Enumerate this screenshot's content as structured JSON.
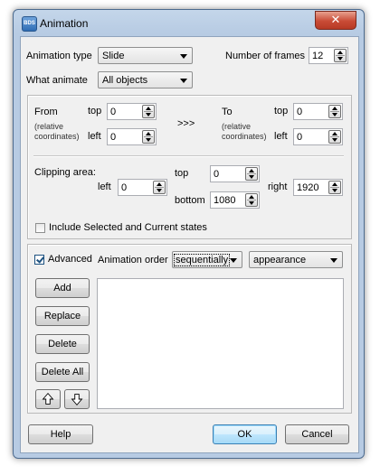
{
  "window": {
    "title": "Animation",
    "close_glyph": "✕",
    "app_icon_text": "BDS"
  },
  "top": {
    "animation_type_label": "Animation type",
    "animation_type_value": "Slide",
    "what_animate_label": "What animate",
    "what_animate_value": "All objects",
    "frames_label": "Number of frames",
    "frames_value": "12"
  },
  "position": {
    "from_label": "From",
    "relative_label_1": "(relative",
    "relative_label_2": "coordinates)",
    "top_label": "top",
    "left_label": "left",
    "from_top": "0",
    "from_left": "0",
    "arrow_text": ">>>",
    "to_label": "To",
    "to_top": "0",
    "to_left": "0"
  },
  "clipping": {
    "label": "Clipping area:",
    "left_label": "left",
    "left_value": "0",
    "top_label": "top",
    "top_value": "0",
    "bottom_label": "bottom",
    "bottom_value": "1080",
    "right_label": "right",
    "right_value": "1920"
  },
  "include_states": {
    "label": "Include Selected and Current states",
    "checked": false
  },
  "advanced": {
    "label": "Advanced",
    "checked": true,
    "order_label": "Animation order",
    "order_value": "sequentially",
    "appearance_value": "appearance",
    "buttons": {
      "add": "Add",
      "replace": "Replace",
      "delete": "Delete",
      "delete_all": "Delete All"
    },
    "move_up_icon": "arrow-up-icon",
    "move_down_icon": "arrow-down-icon"
  },
  "footer": {
    "help": "Help",
    "ok": "OK",
    "cancel": "Cancel"
  },
  "colors": {
    "frame": "#b7cbe3",
    "client": "#f0f0f0",
    "default_button": "#bee6fd",
    "close_button": "#c94b36"
  }
}
